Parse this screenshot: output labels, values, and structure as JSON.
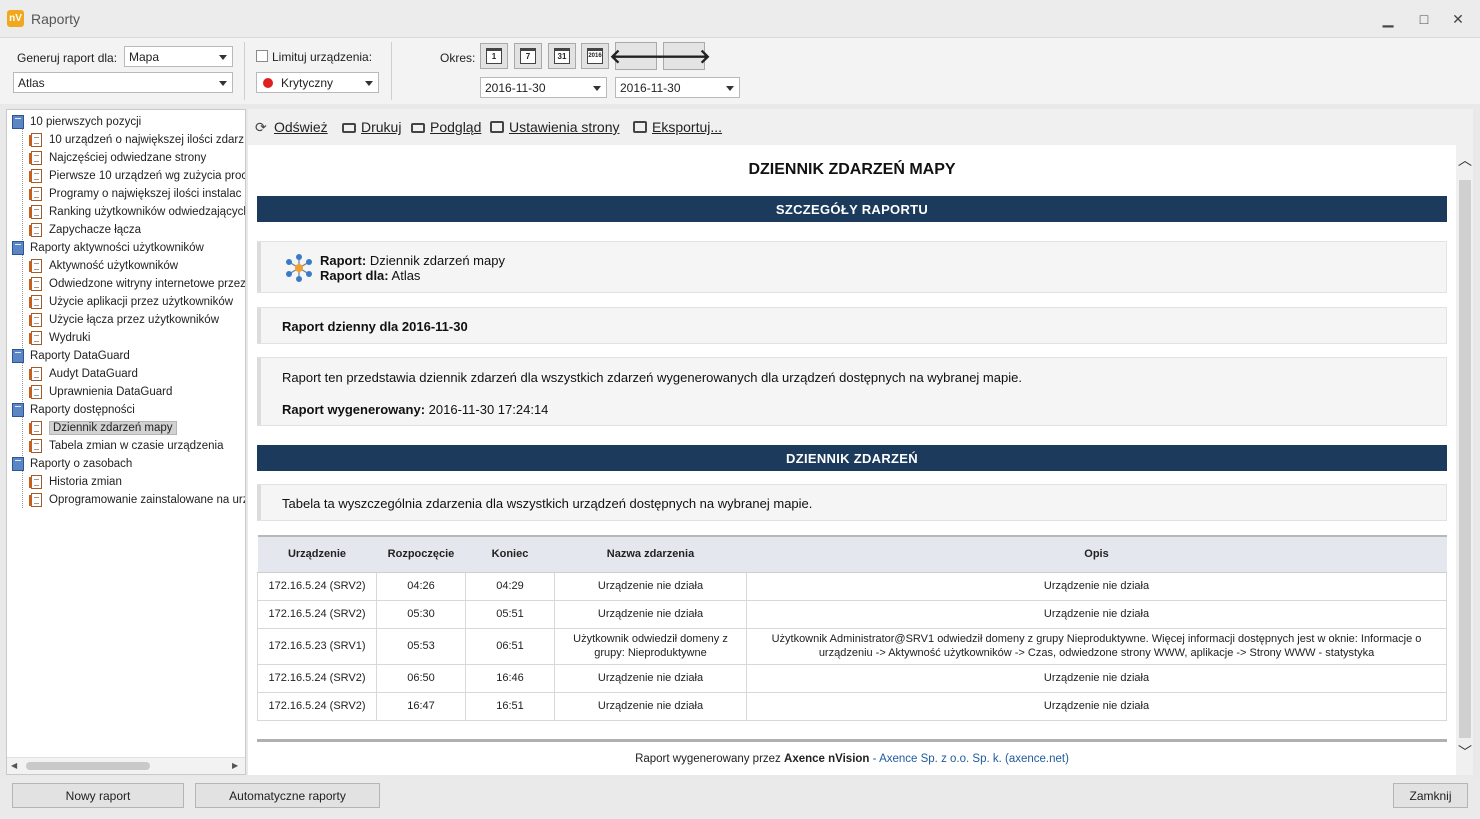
{
  "window": {
    "logo": "nV",
    "title": "Raporty",
    "minimize": "▁",
    "maximize": "□",
    "close": "✕"
  },
  "toolbar": {
    "generate_label": "Generuj raport dla:",
    "scope_value": "Mapa",
    "map_value": "Atlas",
    "limit_label": "Limituj urządzenia:",
    "limit_checked": false,
    "severity_value": "Krytyczny",
    "severity_color": "#e02020",
    "period_label": "Okres:",
    "cal_buttons": [
      "1",
      "7",
      "31",
      "2016"
    ],
    "date_from": "2016-11-30",
    "date_to": "2016-11-30",
    "prev_icon": "arrow-left-icon",
    "next_icon": "arrow-right-icon"
  },
  "tree": {
    "groups": [
      {
        "label": "10 pierwszych pozycji",
        "items": [
          "10 urządzeń o największej ilości zdarz",
          "Najczęściej odwiedzane strony",
          "Pierwsze 10 urządzeń wg zużycia proc",
          "Programy o największej ilości instalac",
          "Ranking użytkowników odwiedzających",
          "Zapychacze łącza"
        ]
      },
      {
        "label": "Raporty aktywności użytkowników",
        "items": [
          "Aktywność użytkowników",
          "Odwiedzone witryny internetowe przez",
          "Użycie aplikacji przez użytkowników",
          "Użycie łącza przez użytkowników",
          "Wydruki"
        ]
      },
      {
        "label": "Raporty DataGuard",
        "items": [
          "Audyt DataGuard",
          "Uprawnienia DataGuard"
        ]
      },
      {
        "label": "Raporty dostępności",
        "items": [
          "Dziennik zdarzeń mapy",
          "Tabela zmian w czasie urządzenia"
        ]
      },
      {
        "label": "Raporty o zasobach",
        "items": [
          "Historia zmian",
          "Oprogramowanie zainstalowane na urz"
        ]
      }
    ],
    "selected": "Dziennik zdarzeń mapy"
  },
  "content_toolbar": {
    "refresh": "Odśwież",
    "print": "Drukuj",
    "preview": "Podgląd",
    "page_setup": "Ustawienia strony",
    "export": "Eksportuj..."
  },
  "report": {
    "title": "DZIENNIK ZDARZEŃ MAPY",
    "details_header": "SZCZEGÓŁY RAPORTU",
    "report_label": "Raport:",
    "report_value": "Dziennik zdarzeń mapy",
    "for_label": "Raport dla:",
    "for_value": "Atlas",
    "daily_heading": "Raport dzienny dla 2016-11-30",
    "description": "Raport ten przedstawia dziennik zdarzeń dla wszystkich zdarzeń wygenerowanych dla urządzeń dostępnych na wybranej mapie.",
    "generated_label": "Raport wygenerowany:",
    "generated_value": "2016-11-30 17:24:14",
    "events_header": "DZIENNIK ZDARZEŃ",
    "events_desc": "Tabela ta wyszczególnia zdarzenia dla wszystkich urządzeń dostępnych na wybranej mapie.",
    "columns": [
      "Urządzenie",
      "Rozpoczęcie",
      "Koniec",
      "Nazwa zdarzenia",
      "Opis"
    ],
    "rows": [
      [
        "172.16.5.24 (SRV2)",
        "04:26",
        "04:29",
        "Urządzenie nie działa",
        "Urządzenie nie działa"
      ],
      [
        "172.16.5.24 (SRV2)",
        "05:30",
        "05:51",
        "Urządzenie nie działa",
        "Urządzenie nie działa"
      ],
      [
        "172.16.5.23 (SRV1)",
        "05:53",
        "06:51",
        "Użytkownik odwiedził domeny z grupy: Nieproduktywne",
        "Użytkownik Administrator@SRV1 odwiedził domeny z grupy Nieproduktywne. Więcej informacji dostępnych jest w oknie: Informacje o urządzeniu -> Aktywność użytkowników -> Czas, odwiedzone strony WWW, aplikacje -> Strony WWW - statystyka"
      ],
      [
        "172.16.5.24 (SRV2)",
        "06:50",
        "16:46",
        "Urządzenie nie działa",
        "Urządzenie nie działa"
      ],
      [
        "172.16.5.24 (SRV2)",
        "16:47",
        "16:51",
        "Urządzenie nie działa",
        "Urządzenie nie działa"
      ]
    ],
    "footer_prefix": "Raport wygenerowany przez",
    "footer_product": "Axence nVision",
    "footer_dash": "-",
    "footer_company": "Axence Sp. z o.o. Sp. k. (axence.net)"
  },
  "bottom": {
    "new_report": "Nowy raport",
    "auto_reports": "Automatyczne raporty",
    "close": "Zamknij"
  }
}
